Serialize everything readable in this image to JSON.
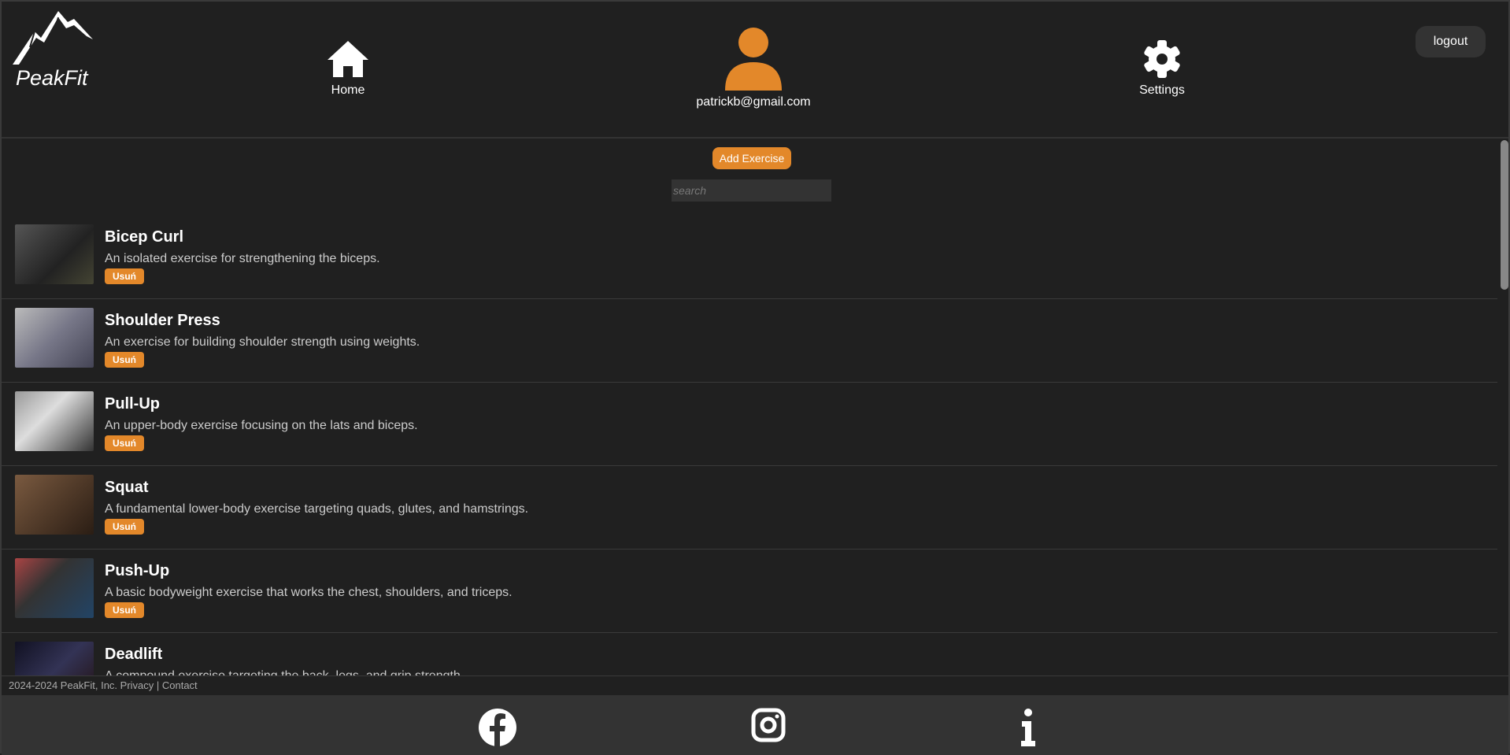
{
  "header": {
    "brand": "PeakFit",
    "home_label": "Home",
    "user_email": "patrickb@gmail.com",
    "settings_label": "Settings",
    "logout_label": "logout"
  },
  "main": {
    "add_label": "Add Exercise",
    "search_placeholder": "search",
    "delete_label": "Usuń",
    "exercises": [
      {
        "title": "Bicep Curl",
        "desc": "An isolated exercise for strengthening the biceps."
      },
      {
        "title": "Shoulder Press",
        "desc": "An exercise for building shoulder strength using weights."
      },
      {
        "title": "Pull-Up",
        "desc": "An upper-body exercise focusing on the lats and biceps."
      },
      {
        "title": "Squat",
        "desc": "A fundamental lower-body exercise targeting quads, glutes, and hamstrings."
      },
      {
        "title": "Push-Up",
        "desc": "A basic bodyweight exercise that works the chest, shoulders, and triceps."
      },
      {
        "title": "Deadlift",
        "desc": "A compound exercise targeting the back, legs, and grip strength."
      }
    ]
  },
  "footer": {
    "copyright": "2024-2024 PeakFit, Inc. Privacy | Contact"
  },
  "colors": {
    "accent": "#e3882a",
    "bg": "#202020",
    "footer": "#333333"
  }
}
